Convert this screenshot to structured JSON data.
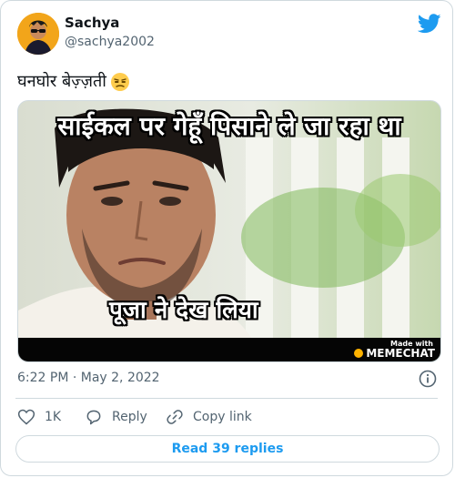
{
  "author": {
    "name": "Sachya",
    "handle": "@sachya2002"
  },
  "tweet": {
    "text": "घनघोर बेज़्ज़ती",
    "emoji": "unamused-face-emoji"
  },
  "media": {
    "caption_top": "साईकल पर गेहूँ पिसाने ले जा रहा था",
    "caption_bottom": "पूजा ने देख लिया",
    "watermark_small": "Made with",
    "watermark_brand": "MEMECHAT"
  },
  "meta": {
    "timestamp": "6:22 PM · May 2, 2022"
  },
  "actions": {
    "like_count": "1K",
    "reply_label": "Reply",
    "copy_link_label": "Copy link"
  },
  "footer": {
    "read_replies": "Read 39 replies"
  },
  "colors": {
    "accent": "#1d9bf0",
    "secondary_text": "#536471",
    "border": "#cfd9de"
  }
}
